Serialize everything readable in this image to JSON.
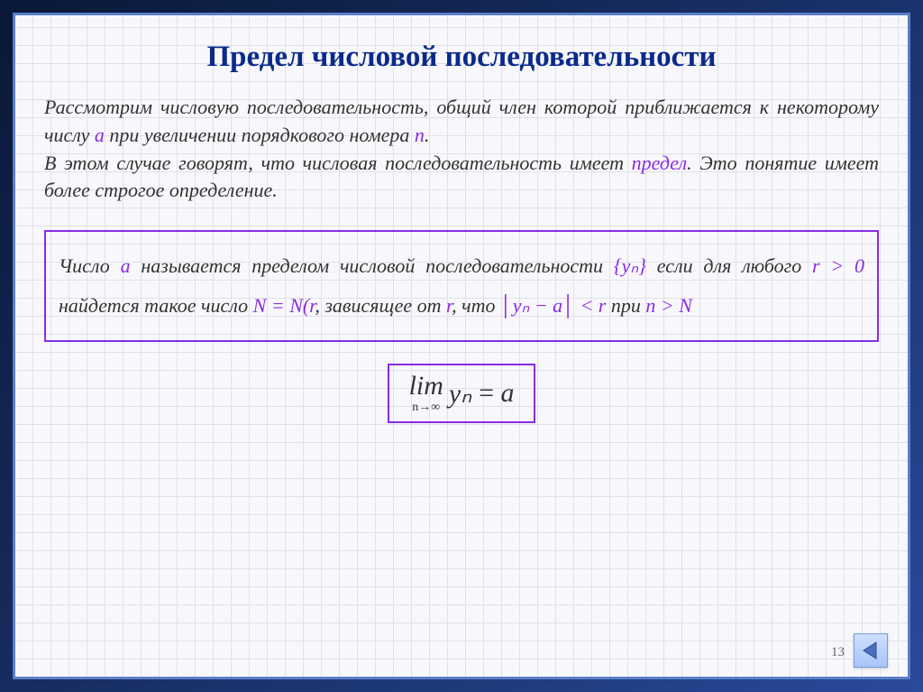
{
  "title": "Предел числовой последовательности",
  "intro": {
    "p1_a": "Рассмотрим числовую последовательность, общий член которой приближается к некоторому числу ",
    "var_a": "a",
    "p1_b": " при увеличении порядкового номера ",
    "var_n": "n",
    "p1_c": ".",
    "p2_a": "В этом случае говорят, что числовая последовательность имеет ",
    "word_limit": "предел",
    "p2_b": ". Это понятие имеет более строгое определение."
  },
  "definition": {
    "d1_a": "Число ",
    "d1_var_a": "a",
    "d1_b": " называется пределом числовой последовательности ",
    "d1_seq": "{yₙ}",
    "d2_a": "если для любого ",
    "d2_rgt0": "r > 0",
    "d2_b": "  найдется такое число ",
    "d2_neq": "N = N(r",
    "d2_c": ", зависящее от ",
    "d2_var_r": "r",
    "d2_d": ", что ",
    "d2_abs_l": "│",
    "d2_expr": "yₙ − a",
    "d2_abs_r": "│",
    "d2_lt": " < r",
    "d2_e": " при ",
    "d2_ngt": "n > N"
  },
  "limit": {
    "lim": "lim",
    "ninf": "n→∞",
    "yn": "yₙ",
    "eq": " = ",
    "a": "a"
  },
  "page_number": "13",
  "colors": {
    "title": "#0a2a8a",
    "accent": "#8a2be2",
    "frame_border": "#5a7ec8"
  }
}
